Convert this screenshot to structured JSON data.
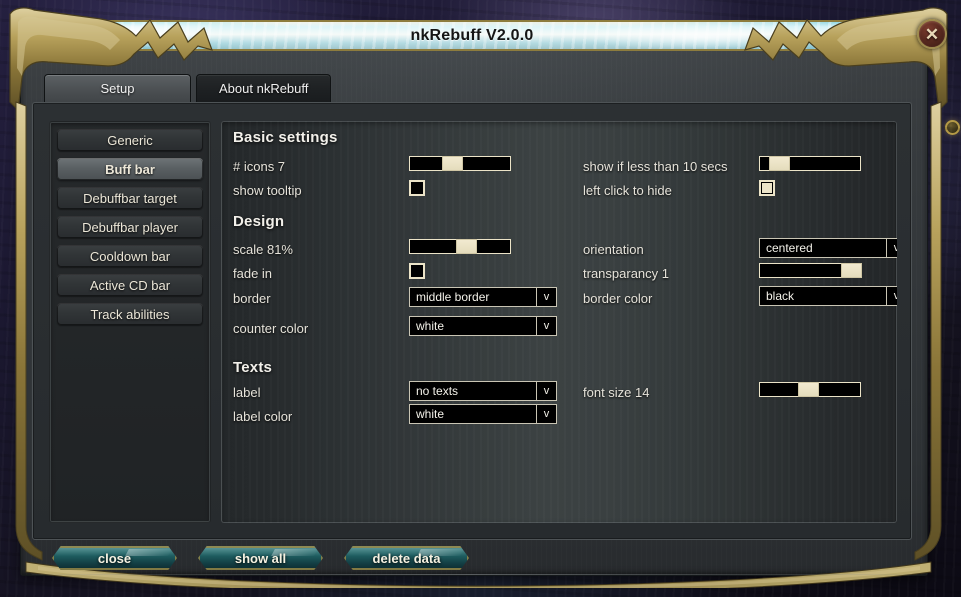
{
  "window": {
    "title": "nkRebuff V2.0.0",
    "close_icon": "close-x-icon"
  },
  "tabs": [
    {
      "label": "Setup",
      "active": true
    },
    {
      "label": "About nkRebuff",
      "active": false
    }
  ],
  "sidebar": {
    "items": [
      {
        "label": "Generic",
        "selected": false
      },
      {
        "label": "Buff bar",
        "selected": true
      },
      {
        "label": "Debuffbar target",
        "selected": false
      },
      {
        "label": "Debuffbar player",
        "selected": false
      },
      {
        "label": "Cooldown bar",
        "selected": false
      },
      {
        "label": "Active CD bar",
        "selected": false
      },
      {
        "label": "Track abilities",
        "selected": false
      }
    ]
  },
  "settings": {
    "sections": [
      {
        "title": "Basic settings"
      },
      {
        "title": "Design"
      },
      {
        "title": "Texts"
      }
    ],
    "basic": {
      "num_icons": {
        "label": "# icons 7",
        "value": 7,
        "slider_pct": 32
      },
      "show_tooltip": {
        "label": "show tooltip",
        "checked": false
      },
      "show_if_less": {
        "label": "show if less than 10 secs",
        "value": 10,
        "slider_pct": 9
      },
      "left_click_hide": {
        "label": "left click to hide",
        "checked": true
      }
    },
    "design": {
      "scale": {
        "label": "scale 81%",
        "value": 81,
        "slider_pct": 46
      },
      "fade_in": {
        "label": "fade in",
        "checked": false
      },
      "border": {
        "label": "border",
        "value": "middle border"
      },
      "counter_color": {
        "label": "counter color",
        "value": "white"
      },
      "orientation": {
        "label": "orientation",
        "value": "centered"
      },
      "transparancy": {
        "label": "transparancy 1",
        "value": 1,
        "slider_pct": 100
      },
      "border_color": {
        "label": "border color",
        "value": "black"
      }
    },
    "texts": {
      "label": {
        "label": "label",
        "value": "no texts"
      },
      "label_color": {
        "label": "label color",
        "value": "white"
      },
      "font_size": {
        "label": "font size 14",
        "value": 14,
        "slider_pct": 38
      }
    },
    "dropdown_arrow": "v"
  },
  "footer": {
    "buttons": [
      {
        "label": "close"
      },
      {
        "label": "show all"
      },
      {
        "label": "delete data"
      }
    ]
  },
  "colors": {
    "gold_frame": "#a89350",
    "title_glow": "#9fe6ee",
    "slider_cream": "#ece4c8",
    "button_teal": "#1f5f62",
    "close_red": "#5a2a20"
  }
}
